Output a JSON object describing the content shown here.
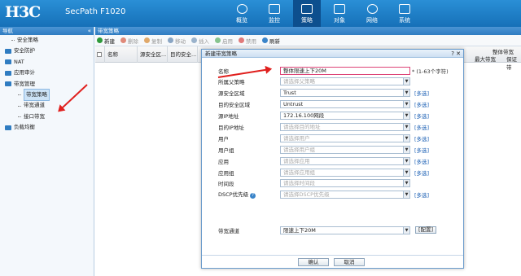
{
  "header": {
    "logo": "H3C",
    "product": "SecPath F1020",
    "nav": [
      {
        "label": "概览",
        "icon": "overview-icon"
      },
      {
        "label": "监控",
        "icon": "monitor-icon"
      },
      {
        "label": "策略",
        "icon": "policy-icon",
        "active": true
      },
      {
        "label": "对象",
        "icon": "object-icon"
      },
      {
        "label": "网络",
        "icon": "network-icon"
      },
      {
        "label": "系统",
        "icon": "system-icon"
      }
    ]
  },
  "sidebar": {
    "title": "导航",
    "collapse": "«",
    "items": [
      {
        "label": "安全策略",
        "level": 1,
        "type": "leaf"
      },
      {
        "label": "安全防护",
        "level": 0,
        "type": "folder"
      },
      {
        "label": "NAT",
        "level": 0,
        "type": "folder"
      },
      {
        "label": "应用审计",
        "level": 0,
        "type": "folder"
      },
      {
        "label": "带宽管理",
        "level": 0,
        "type": "folder"
      },
      {
        "label": "带宽策略",
        "level": 2,
        "type": "leaf",
        "selected": true
      },
      {
        "label": "带宽通道",
        "level": 2,
        "type": "leaf"
      },
      {
        "label": "接口带宽",
        "level": 2,
        "type": "leaf"
      },
      {
        "label": "负载均衡",
        "level": 0,
        "type": "folder"
      }
    ]
  },
  "content": {
    "tab": "带宽策略",
    "toolbar": [
      {
        "label": "新建",
        "color": "#2e9a3b",
        "disabled": false
      },
      {
        "label": "删除",
        "color": "#e08a7a",
        "disabled": true
      },
      {
        "label": "复制",
        "color": "#e0a96b",
        "disabled": true
      },
      {
        "label": "移动",
        "color": "#8aa6c4",
        "disabled": true
      },
      {
        "label": "插入",
        "color": "#9bb3cc",
        "disabled": true
      },
      {
        "label": "启用",
        "color": "#86c48e",
        "disabled": true
      },
      {
        "label": "禁用",
        "color": "#e07a7a",
        "disabled": true
      },
      {
        "label": "刷新",
        "color": "#3a84c9",
        "disabled": false
      }
    ],
    "columns": [
      "名称",
      "源安全区...",
      "目的安全..."
    ],
    "right_group": "整体带宽",
    "right_columns": [
      "最大带宽",
      "保证带"
    ]
  },
  "dialog": {
    "title": "新建带宽策略",
    "controls": "? ✕",
    "fields": [
      {
        "label": "名称",
        "value": "整体限速上下20M",
        "placeholder": false,
        "hint": "* (1-63个字符)",
        "dropdown": false
      },
      {
        "label": "所属父策略",
        "value": "请选择父策略",
        "placeholder": true,
        "dropdown": true
      },
      {
        "label": "源安全区域",
        "value": "Trust",
        "placeholder": false,
        "dropdown": true,
        "multi": "[多选]"
      },
      {
        "label": "目的安全区域",
        "value": "Untrust",
        "placeholder": false,
        "dropdown": true,
        "multi": "[多选]"
      },
      {
        "label": "源IP地址",
        "value": "172.16.100网段",
        "placeholder": false,
        "dropdown": true,
        "multi": "[多选]"
      },
      {
        "label": "目的IP地址",
        "value": "请选择目的地址",
        "placeholder": true,
        "dropdown": true,
        "multi": "[多选]"
      },
      {
        "label": "用户",
        "value": "请选择用户",
        "placeholder": true,
        "dropdown": true,
        "multi": "[多选]"
      },
      {
        "label": "用户组",
        "value": "请选择用户组",
        "placeholder": true,
        "dropdown": true,
        "multi": "[多选]"
      },
      {
        "label": "应用",
        "value": "请选择应用",
        "placeholder": true,
        "dropdown": true,
        "multi": "[多选]"
      },
      {
        "label": "应用组",
        "value": "请选择应用组",
        "placeholder": true,
        "dropdown": true,
        "multi": "[多选]"
      },
      {
        "label": "时间段",
        "value": "请选择时间段",
        "placeholder": true,
        "dropdown": true
      },
      {
        "label": "DSCP优先级",
        "value": "请选择DSCP优先级",
        "placeholder": true,
        "dropdown": true,
        "multi": "[多选]",
        "help": true
      }
    ],
    "channel": {
      "label": "带宽通道",
      "value": "限速上下20M",
      "button": "[配置]"
    },
    "ok": "确认",
    "cancel": "取消"
  },
  "accent_colors": {
    "header": "#1670b8",
    "arrow": "#e0201e",
    "link": "#1a5fb4"
  }
}
